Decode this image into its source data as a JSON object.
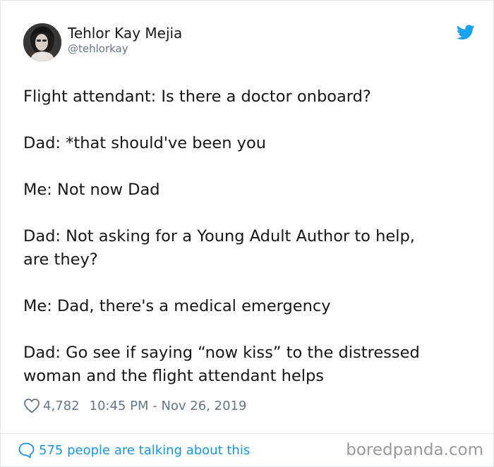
{
  "tweet": {
    "author_name": "Tehlor Kay Mejia",
    "author_handle": "@tehlorkay",
    "paragraphs": [
      [
        "Flight attendant: Is there a doctor onboard?"
      ],
      [
        "Dad: *that should've been you"
      ],
      [
        "Me: Not now Dad"
      ],
      [
        "Dad: Not asking for a Young Adult Author to help,",
        "are they?"
      ],
      [
        "Me: Dad, there's a medical emergency"
      ],
      [
        "Dad: Go see if saying “now kiss” to the distressed",
        "woman and the flight attendant helps"
      ]
    ],
    "likes": "4,782",
    "timestamp": "10:45 PM - Nov 26, 2019",
    "conversation_link": "575 people are talking about this"
  },
  "watermark": "boredpanda.com",
  "icons": {
    "brand": "twitter-bird-icon",
    "like": "heart-icon",
    "reply": "speech-bubble-icon"
  },
  "colors": {
    "twitter_blue": "#1da1f2",
    "link_blue": "#1b95e0",
    "muted_text": "#657786",
    "main_text": "#14171a",
    "border": "#e1e8ed"
  }
}
